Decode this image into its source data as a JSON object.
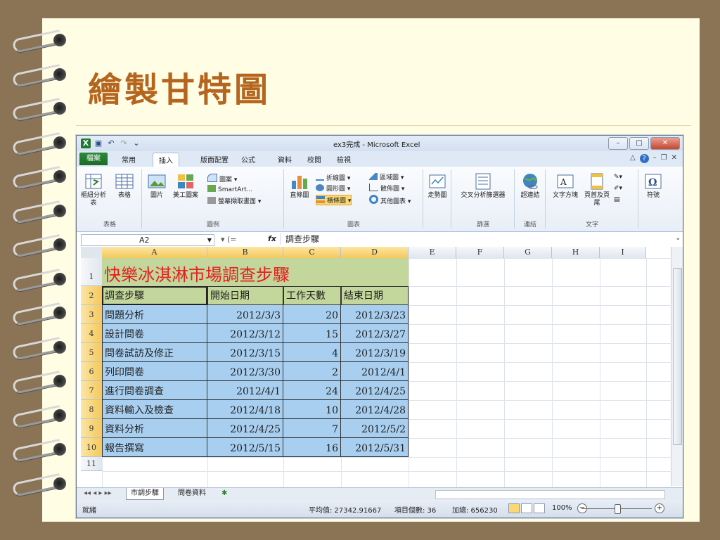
{
  "slide": {
    "title": "繪製甘特圖"
  },
  "window": {
    "title": "ex3完成 - Microsoft Excel",
    "controls": [
      "–",
      "□",
      "✕"
    ]
  },
  "tabs": {
    "file": "檔案",
    "items": [
      "常用",
      "插入",
      "版面配置",
      "公式",
      "資料",
      "校閱",
      "檢視"
    ],
    "active": "插入"
  },
  "ribbon": {
    "tables": {
      "pivot": "樞紐分析表",
      "table": "表格",
      "group": "表格"
    },
    "illustrations": {
      "picture": "圖片",
      "clipart": "美工圖案",
      "shapes": "圖案",
      "smartart": "SmartArt...",
      "screenshot": "螢幕擷取畫面",
      "group": "圖例"
    },
    "charts": {
      "column": "直條圖",
      "line": "折線圖",
      "pie": "圓形圖",
      "bar": "橫條圖",
      "area": "區域圖",
      "scatter": "散佈圖",
      "other": "其他圖表",
      "group": "圖表"
    },
    "sparklines": {
      "line": "走勢圖"
    },
    "filter": {
      "slicer": "交叉分析篩選器",
      "group": "篩選"
    },
    "links": {
      "hyperlink": "超連結",
      "group": "連結"
    },
    "text": {
      "textbox": "文字方塊",
      "header": "頁首及頁尾",
      "group": "文字"
    },
    "symbols": {
      "symbol": "符號"
    }
  },
  "formula_bar": {
    "name_box": "A2",
    "fx": "fx",
    "content": "調查步驟"
  },
  "columns": [
    "A",
    "B",
    "C",
    "D",
    "E",
    "F",
    "G",
    "H",
    "I"
  ],
  "rows": [
    "1",
    "2",
    "3",
    "4",
    "5",
    "6",
    "7",
    "8",
    "9",
    "10",
    "11"
  ],
  "sheet": {
    "header_title": "快樂冰淇淋市場調查步驟",
    "col_headers": [
      "調查步驟",
      "開始日期",
      "工作天數",
      "結束日期"
    ],
    "data": [
      [
        "問題分析",
        "2012/3/3",
        "20",
        "2012/3/23"
      ],
      [
        "設計問卷",
        "2012/3/12",
        "15",
        "2012/3/27"
      ],
      [
        "問卷試訪及修正",
        "2012/3/15",
        "4",
        "2012/3/19"
      ],
      [
        "列印問卷",
        "2012/3/30",
        "2",
        "2012/4/1"
      ],
      [
        "進行問卷調查",
        "2012/4/1",
        "24",
        "2012/4/25"
      ],
      [
        "資料輸入及檢查",
        "2012/4/18",
        "10",
        "2012/4/28"
      ],
      [
        "資料分析",
        "2012/4/25",
        "7",
        "2012/5/2"
      ],
      [
        "報告撰寫",
        "2012/5/15",
        "16",
        "2012/5/31"
      ]
    ]
  },
  "sheet_tabs": {
    "nav": "◂◂ ◂ ▸ ▸▸",
    "tabs": [
      "市調步驟",
      "問卷資料"
    ]
  },
  "status_bar": {
    "mode": "就緒",
    "average": "平均值: 27342.91667",
    "count": "項目個數: 36",
    "sum": "加總: 656230",
    "zoom": "100%"
  },
  "colors": {
    "title": "#b5651d",
    "header_fill": "#c3d69b",
    "body_fill": "#a9cff0",
    "red_title": "#e41f1f"
  }
}
